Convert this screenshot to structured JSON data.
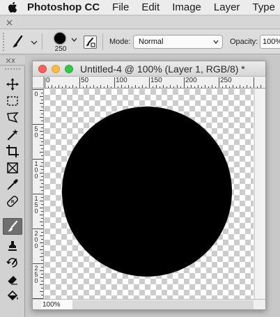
{
  "menubar": {
    "apple_icon": "apple-icon",
    "app_name": "Photoshop CC",
    "items": [
      "File",
      "Edit",
      "Image",
      "Layer",
      "Type"
    ]
  },
  "options_bar": {
    "brush_size": "250",
    "mode_label": "Mode:",
    "mode_value": "Normal",
    "opacity_label": "Opacity:",
    "opacity_value": "100%"
  },
  "tools": [
    {
      "name": "move-tool",
      "icon": "move-icon",
      "active": false
    },
    {
      "name": "marquee-tool",
      "icon": "rect-marquee-icon",
      "active": false
    },
    {
      "name": "lasso-tool",
      "icon": "polygonal-lasso-icon",
      "active": false
    },
    {
      "name": "magic-wand-tool",
      "icon": "magic-wand-icon",
      "active": false
    },
    {
      "name": "crop-tool",
      "icon": "crop-icon",
      "active": false
    },
    {
      "name": "frame-tool",
      "icon": "frame-icon",
      "active": false
    },
    {
      "name": "eyedropper-tool",
      "icon": "eyedropper-icon",
      "active": false
    },
    {
      "name": "healing-brush-tool",
      "icon": "bandage-icon",
      "active": false
    },
    {
      "name": "brush-tool",
      "icon": "brush-icon",
      "active": true
    },
    {
      "name": "clone-stamp-tool",
      "icon": "stamp-icon",
      "active": false
    },
    {
      "name": "history-brush-tool",
      "icon": "history-brush-icon",
      "active": false
    },
    {
      "name": "eraser-tool",
      "icon": "eraser-icon",
      "active": false
    },
    {
      "name": "paint-bucket-tool",
      "icon": "paint-bucket-icon",
      "active": false
    }
  ],
  "document": {
    "title": "Untitled-4 @ 100% (Layer 1, RGB/8) *",
    "ruler_h_labels": [
      "0",
      "50",
      "100",
      "150",
      "200",
      "250"
    ],
    "ruler_v_labels": [
      "0",
      "5 0",
      "1 0 0",
      "1 5 0",
      "2 0 0",
      "2 5 0"
    ],
    "zoom": "100%"
  },
  "colors": {
    "close": "#fc605c",
    "minimize": "#fdbc40",
    "zoom": "#34c84a",
    "painted_circle": "#000000",
    "active_tool_bg": "#6f6f6f"
  }
}
